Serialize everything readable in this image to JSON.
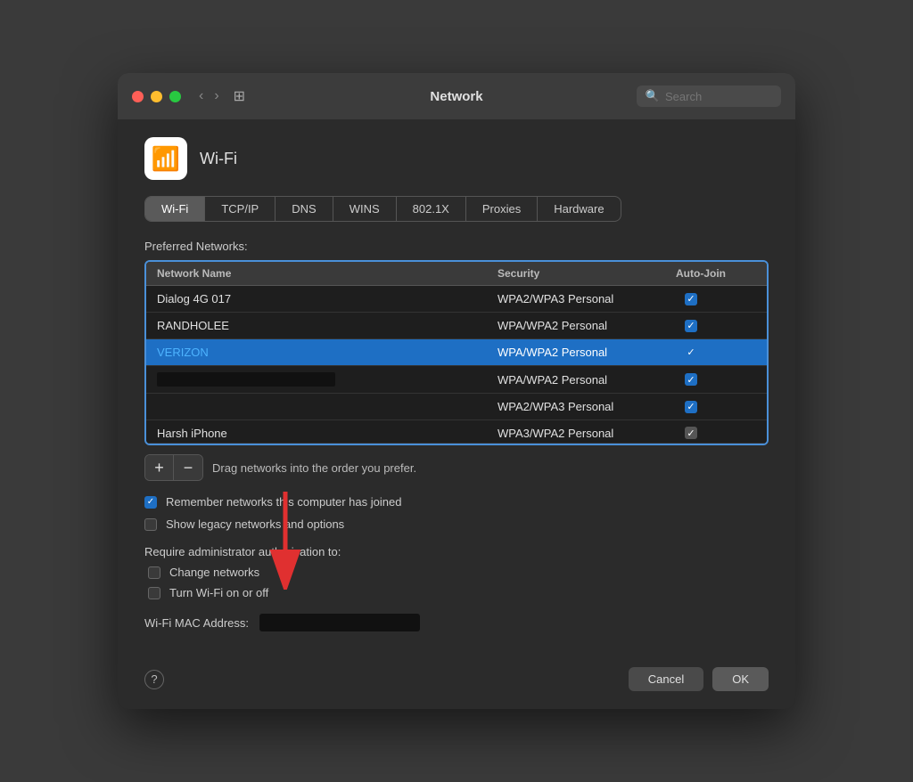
{
  "titlebar": {
    "title": "Network",
    "search_placeholder": "Search"
  },
  "wifi_section": {
    "icon_label": "Wi-Fi icon",
    "title": "Wi-Fi"
  },
  "tabs": [
    {
      "label": "Wi-Fi",
      "active": true
    },
    {
      "label": "TCP/IP",
      "active": false
    },
    {
      "label": "DNS",
      "active": false
    },
    {
      "label": "WINS",
      "active": false
    },
    {
      "label": "802.1X",
      "active": false
    },
    {
      "label": "Proxies",
      "active": false
    },
    {
      "label": "Hardware",
      "active": false
    }
  ],
  "preferred_networks": {
    "label": "Preferred Networks:",
    "columns": {
      "network_name": "Network Name",
      "security": "Security",
      "auto_join": "Auto-Join"
    },
    "rows": [
      {
        "name": "Dialog 4G 017",
        "security": "WPA2/WPA3 Personal",
        "auto_join": true,
        "selected": false,
        "redacted": false
      },
      {
        "name": "RANDHOLEE",
        "security": "WPA/WPA2 Personal",
        "auto_join": true,
        "selected": false,
        "redacted": false
      },
      {
        "name": "VERIZON",
        "security": "WPA/WPA2 Personal",
        "auto_join": true,
        "selected": true,
        "redacted": false
      },
      {
        "name": "REDACTED",
        "security": "WPA/WPA2 Personal",
        "auto_join": true,
        "selected": false,
        "redacted": true
      },
      {
        "name": "",
        "security": "WPA2/WPA3 Personal",
        "auto_join": true,
        "selected": false,
        "redacted": true
      },
      {
        "name": "Harsh iPhone",
        "security": "WPA3/WPA2 Personal",
        "auto_join": true,
        "selected": false,
        "partial": true
      }
    ],
    "drag_hint": "Drag networks into the order you prefer."
  },
  "add_btn": "+",
  "remove_btn": "−",
  "options": {
    "remember_label": "Remember networks this computer has joined",
    "remember_checked": true,
    "legacy_label": "Show legacy networks and options",
    "legacy_checked": false
  },
  "require_admin": {
    "label": "Require administrator authorisation to:",
    "change_networks_label": "Change networks",
    "change_networks_checked": false,
    "turn_wifi_label": "Turn Wi-Fi on or off",
    "turn_wifi_checked": false
  },
  "mac_address": {
    "label": "Wi-Fi MAC Address:"
  },
  "footer": {
    "help_label": "?",
    "cancel_label": "Cancel",
    "ok_label": "OK"
  }
}
